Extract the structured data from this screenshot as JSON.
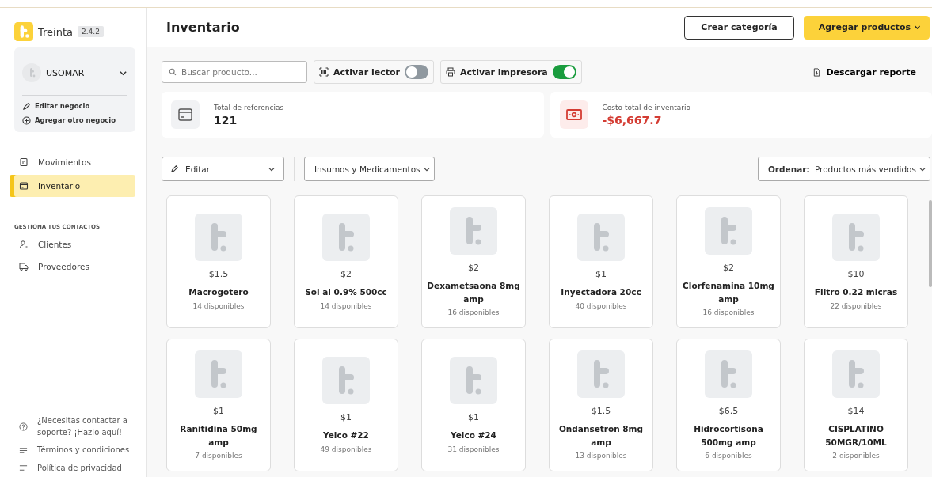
{
  "app": {
    "name": "Treinta",
    "version": "2.4.2"
  },
  "business": {
    "name": "USOMAR",
    "actions": [
      {
        "kind": "edit",
        "label": "Editar negocio"
      },
      {
        "kind": "add",
        "label": "Agregar otro negocio"
      }
    ]
  },
  "nav": [
    {
      "kind": "receipt",
      "label": "Movimientos",
      "selected": false
    },
    {
      "kind": "box",
      "label": "Inventario",
      "selected": true
    }
  ],
  "contacts": {
    "heading": "GESTIONA TUS CONTACTOS",
    "items": [
      {
        "kind": "person",
        "label": "Clientes"
      },
      {
        "kind": "truck",
        "label": "Proveedores"
      }
    ]
  },
  "footer_links": [
    {
      "kind": "help",
      "label": "¿Necesitas contactar a soporte? ¡Hazlo aquí!"
    },
    {
      "kind": "lines",
      "label": "Términos y condiciones"
    },
    {
      "kind": "lines",
      "label": "Política de privacidad"
    }
  ],
  "header": {
    "title": "Inventario",
    "buttons": [
      {
        "kind": "outline",
        "label": "Crear categoría"
      },
      {
        "kind": "primary",
        "label": "Agregar productos"
      }
    ]
  },
  "toolbar": {
    "search": {
      "placeholder": "Buscar producto..."
    },
    "toggles": [
      {
        "kind": "scanner",
        "label": "Activar lector",
        "on": false
      },
      {
        "kind": "printer",
        "label": "Activar impresora",
        "on": true
      }
    ],
    "download": "Descargar reporte"
  },
  "stats": [
    {
      "kind": "box",
      "label": "Total de referencias",
      "value": "121"
    },
    {
      "kind": "money",
      "label": "Costo total de inventario",
      "value": "-$6,667.7"
    }
  ],
  "filters": {
    "edit": "Editar",
    "category": "Insumos y Medicamentos",
    "sort_label": "Ordenar:",
    "sort_value": "Productos más vendidos"
  },
  "products": [
    {
      "price": "$1.5",
      "name": "Macrogotero",
      "stock": "14 disponibles"
    },
    {
      "price": "$2",
      "name": "Sol al 0.9% 500cc",
      "stock": "14 disponibles"
    },
    {
      "price": "$2",
      "name": "Dexametsaona 8mg amp",
      "stock": "16 disponibles"
    },
    {
      "price": "$1",
      "name": "Inyectadora 20cc",
      "stock": "40 disponibles"
    },
    {
      "price": "$2",
      "name": "Clorfenamina 10mg amp",
      "stock": "16 disponibles"
    },
    {
      "price": "$10",
      "name": "Filtro 0.22 micras",
      "stock": "22 disponibles"
    },
    {
      "price": "$1",
      "name": "Ranitidina 50mg amp",
      "stock": "7 disponibles"
    },
    {
      "price": "$1",
      "name": "Yelco #22",
      "stock": "49 disponibles"
    },
    {
      "price": "$1",
      "name": "Yelco #24",
      "stock": "31 disponibles"
    },
    {
      "price": "$1.5",
      "name": "Ondansetron 8mg amp",
      "stock": "13 disponibles"
    },
    {
      "price": "$6.5",
      "name": "Hidrocortisona 500mg amp",
      "stock": "6 disponibles"
    },
    {
      "price": "$14",
      "name": "CISPLATINO 50MGR/10ML",
      "stock": "2 disponibles"
    }
  ]
}
